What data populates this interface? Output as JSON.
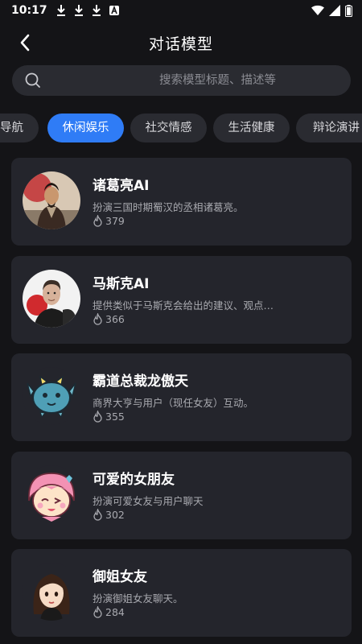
{
  "status_bar": {
    "time": "10:17"
  },
  "header": {
    "title": "对话模型"
  },
  "search": {
    "placeholder": "搜索模型标题、描述等"
  },
  "tabs": [
    {
      "label": "导航",
      "active": false
    },
    {
      "label": "休闲娱乐",
      "active": true
    },
    {
      "label": "社交情感",
      "active": false
    },
    {
      "label": "生活健康",
      "active": false
    },
    {
      "label": "辩论演讲",
      "active": false
    }
  ],
  "cards": [
    {
      "title": "诸葛亮AI",
      "desc": "扮演三国时期蜀汉的丞相诸葛亮。",
      "hot": "379",
      "avatar": "zhuge-liang-avatar"
    },
    {
      "title": "马斯克AI",
      "desc": "提供类似于马斯克会给出的建议、观点…",
      "hot": "366",
      "avatar": "musk-avatar"
    },
    {
      "title": "霸道总裁龙傲天",
      "desc": "商界大亨与用户（现任女友）互动。",
      "hot": "355",
      "avatar": "blue-monster-avatar"
    },
    {
      "title": "可爱的女朋友",
      "desc": "扮演可爱女友与用户聊天",
      "hot": "302",
      "avatar": "pink-girl-avatar"
    },
    {
      "title": "御姐女友",
      "desc": "扮演御姐女友聊天。",
      "hot": "284",
      "avatar": "mature-girl-avatar"
    }
  ],
  "colors": {
    "accent": "#2f7cf6",
    "background": "#141417",
    "card": "#24252c"
  }
}
